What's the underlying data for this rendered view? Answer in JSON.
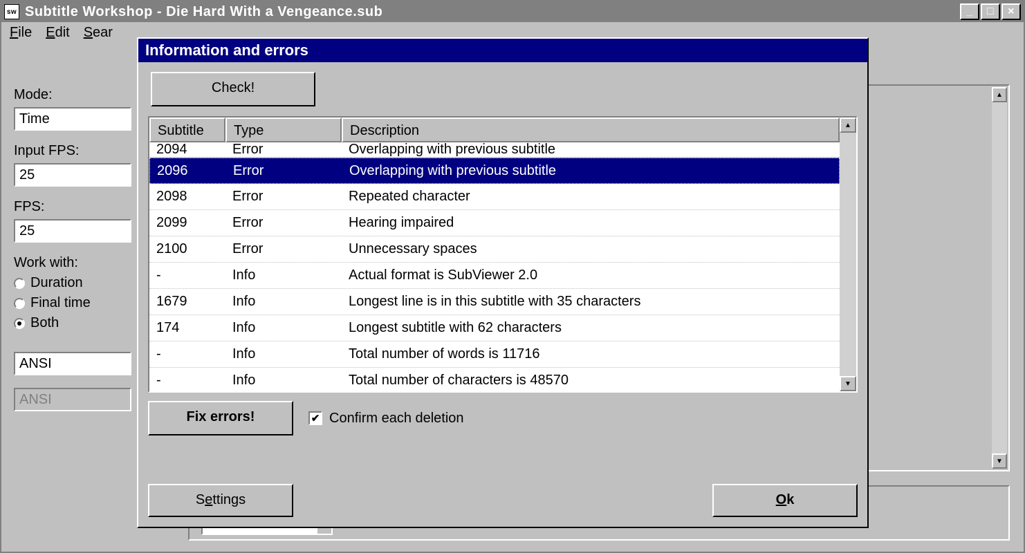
{
  "main": {
    "title": "Subtitle Workshop - Die Hard With a Vengeance.sub",
    "menus": {
      "file": "File",
      "edit": "Edit",
      "search": "Search"
    }
  },
  "sidebar": {
    "mode_label": "Mode:",
    "mode_value": "Time",
    "inputfps_label": "Input FPS:",
    "inputfps_value": "25",
    "fps_label": "FPS:",
    "fps_value": "25",
    "workwith_label": "Work with:",
    "workwith": {
      "duration": "Duration",
      "finaltime": "Final time",
      "both": "Both",
      "selected": "both"
    },
    "charset1": "ANSI",
    "charset2": "ANSI"
  },
  "dialog": {
    "title": "Information and errors",
    "check_label": "Check!",
    "fix_label": "Fix errors!",
    "confirm_label": "Confirm each deletion",
    "settings_label": "Settings",
    "ok_label": "Ok",
    "columns": {
      "subtitle": "Subtitle",
      "type": "Type",
      "description": "Description"
    },
    "rows": [
      {
        "subtitle": "2094",
        "type": "Error",
        "description": "Overlapping with previous subtitle",
        "cut": true
      },
      {
        "subtitle": "2096",
        "type": "Error",
        "description": "Overlapping with previous subtitle",
        "selected": true
      },
      {
        "subtitle": "2098",
        "type": "Error",
        "description": "Repeated character"
      },
      {
        "subtitle": "2099",
        "type": "Error",
        "description": "Hearing impaired"
      },
      {
        "subtitle": "2100",
        "type": "Error",
        "description": "Unnecessary spaces"
      },
      {
        "subtitle": "-",
        "type": "Info",
        "description": "Actual format is SubViewer 2.0"
      },
      {
        "subtitle": "1679",
        "type": "Info",
        "description": "Longest line is in this subtitle with 35 characters"
      },
      {
        "subtitle": "174",
        "type": "Info",
        "description": "Longest subtitle with 62 characters"
      },
      {
        "subtitle": "-",
        "type": "Info",
        "description": "Total number of words is 11716"
      },
      {
        "subtitle": "-",
        "type": "Info",
        "description": "Total number of characters is 48570"
      }
    ]
  }
}
